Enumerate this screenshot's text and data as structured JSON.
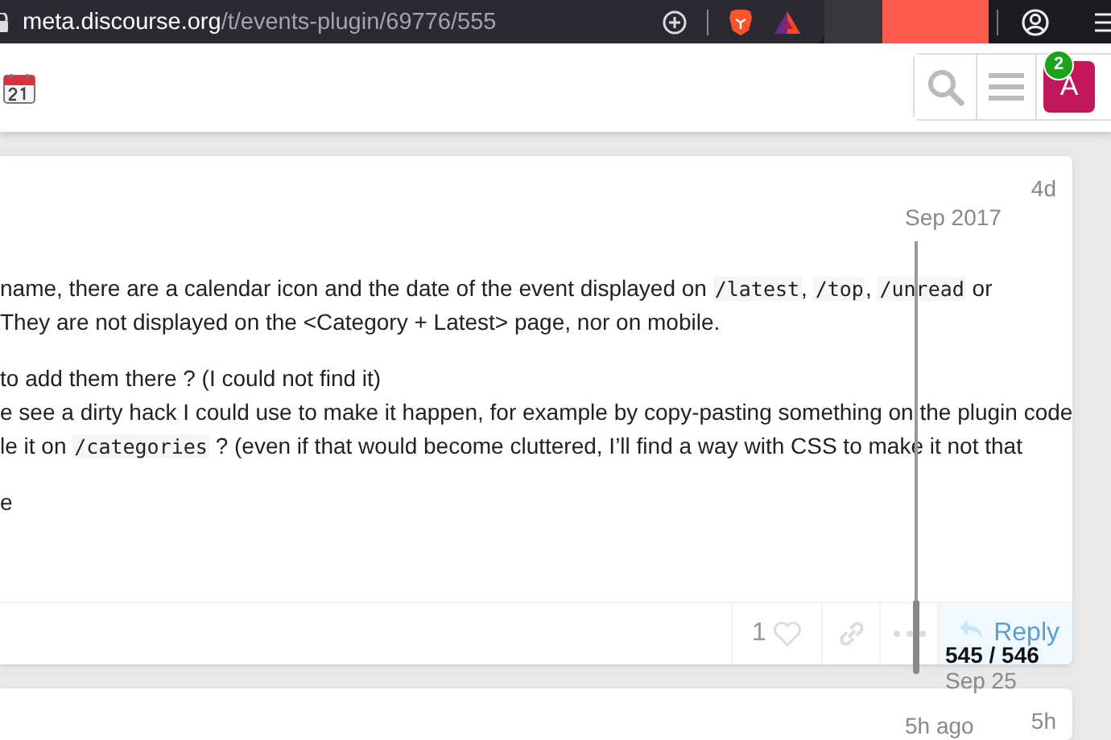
{
  "browser": {
    "url_domain": "meta.discourse.org",
    "url_path": "/t/events-plugin/69776/555"
  },
  "header": {
    "notification_count": "2",
    "avatar_letter": "A"
  },
  "post": {
    "age": "4d",
    "paragraphs": [
      [
        [
          {
            "kind": "text",
            "text": "name, there are a calendar icon and the date of the event displayed on "
          },
          {
            "kind": "code",
            "text": "/latest"
          },
          {
            "kind": "text",
            "text": ", "
          },
          {
            "kind": "code",
            "text": "/top"
          },
          {
            "kind": "text",
            "text": ", "
          },
          {
            "kind": "code",
            "text": "/unread"
          },
          {
            "kind": "text",
            "text": " or"
          }
        ],
        [
          {
            "kind": "text",
            "text": "They are not displayed on the <Category + Latest> page, nor on mobile."
          }
        ]
      ],
      [
        [
          {
            "kind": "text",
            "text": "to add them there ? (I could not find it)"
          }
        ],
        [
          {
            "kind": "text",
            "text": "e see a dirty hack I could use to make it happen, for example by copy-pasting something on the plugin code"
          }
        ],
        [
          {
            "kind": "text",
            "text": "le it on "
          },
          {
            "kind": "code",
            "text": "/categories"
          },
          {
            "kind": "text",
            "text": " ? (even if that would become cluttered, I’ll find a way with CSS to make it not that"
          }
        ]
      ],
      [
        [
          {
            "kind": "text",
            "text": "e"
          }
        ]
      ]
    ],
    "like_count": "1",
    "reply_label": "Reply"
  },
  "timeline": {
    "start_date": "Sep 2017",
    "position": "545 / 546",
    "current_date": "Sep 25",
    "end_date": "5h ago",
    "level": 0.95
  },
  "next_post": {
    "age": "5h"
  }
}
